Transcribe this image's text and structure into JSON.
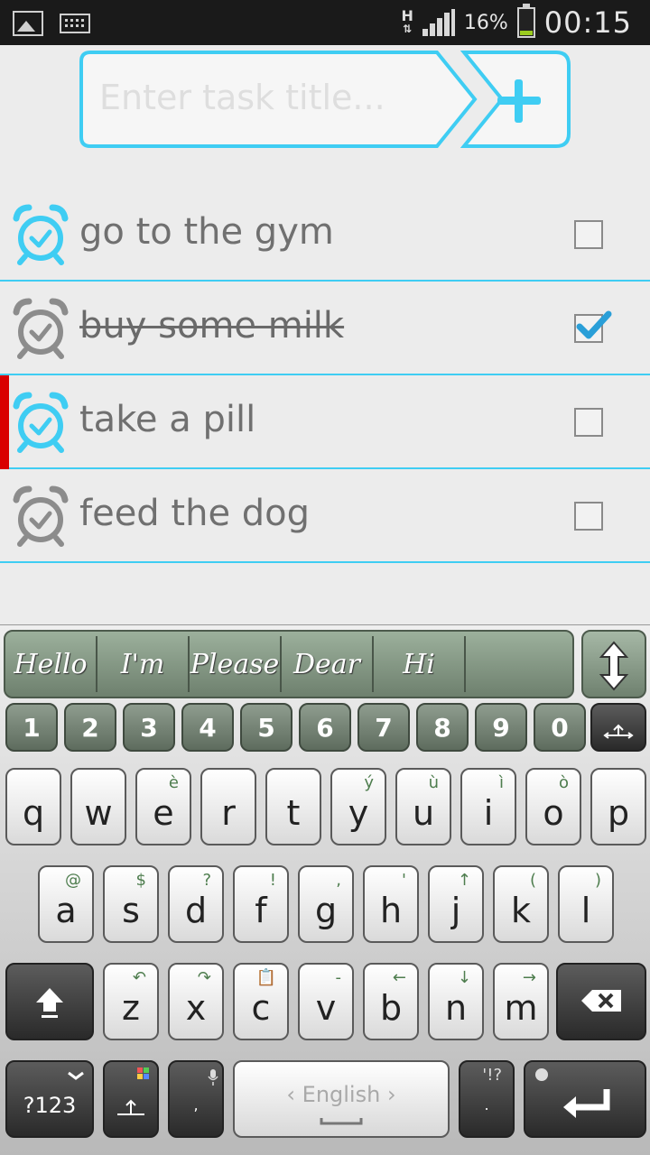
{
  "status_bar": {
    "network_type": "H",
    "battery_percent": "16%",
    "battery_level": 0.16,
    "time": "00:15",
    "icons": [
      "image-notification-icon",
      "keyboard-notification-icon",
      "h-data-icon",
      "signal-icon",
      "battery-icon"
    ]
  },
  "task_input": {
    "placeholder": "Enter task title...",
    "value": "",
    "add_icon": "plus-icon",
    "accent_color": "#3fcdf3"
  },
  "tasks": [
    {
      "title": "go to the gym",
      "completed": false,
      "alarm_active": true,
      "high_priority": false
    },
    {
      "title": "buy some milk",
      "completed": true,
      "alarm_active": false,
      "high_priority": false
    },
    {
      "title": "take a pill",
      "completed": false,
      "alarm_active": true,
      "high_priority": true
    },
    {
      "title": "feed the dog",
      "completed": false,
      "alarm_active": false,
      "high_priority": false
    }
  ],
  "colors": {
    "alarm_active": "#3fcdf3",
    "alarm_inactive": "#8c8c8c",
    "priority": "#d90000",
    "divider": "#3fcdf3"
  },
  "keyboard": {
    "suggestions": [
      "Hello",
      "I'm",
      "Please",
      "Dear",
      "Hi"
    ],
    "number_row": [
      "1",
      "2",
      "3",
      "4",
      "5",
      "6",
      "7",
      "8",
      "9",
      "0"
    ],
    "row1": [
      {
        "key": "q",
        "sub": ""
      },
      {
        "key": "w",
        "sub": ""
      },
      {
        "key": "e",
        "sub": "è"
      },
      {
        "key": "r",
        "sub": ""
      },
      {
        "key": "t",
        "sub": ""
      },
      {
        "key": "y",
        "sub": "ý"
      },
      {
        "key": "u",
        "sub": "ù"
      },
      {
        "key": "i",
        "sub": "ì"
      },
      {
        "key": "o",
        "sub": "ò"
      },
      {
        "key": "p",
        "sub": ""
      }
    ],
    "row2": [
      {
        "key": "a",
        "sub": "@"
      },
      {
        "key": "s",
        "sub": "$"
      },
      {
        "key": "d",
        "sub": "?"
      },
      {
        "key": "f",
        "sub": "!"
      },
      {
        "key": "g",
        "sub": ","
      },
      {
        "key": "h",
        "sub": "'"
      },
      {
        "key": "j",
        "sub": "↑"
      },
      {
        "key": "k",
        "sub": "("
      },
      {
        "key": "l",
        "sub": ")"
      }
    ],
    "row3": [
      {
        "key": "z",
        "sub": "↶"
      },
      {
        "key": "x",
        "sub": "↷"
      },
      {
        "key": "c",
        "sub": "📋"
      },
      {
        "key": "v",
        "sub": "-"
      },
      {
        "key": "b",
        "sub": "←"
      },
      {
        "key": "n",
        "sub": "↓"
      },
      {
        "key": "m",
        "sub": "→"
      }
    ],
    "symbols_label": "?123",
    "comma": ",",
    "period": ".",
    "period_sub": "'!?",
    "space_label": "English"
  }
}
